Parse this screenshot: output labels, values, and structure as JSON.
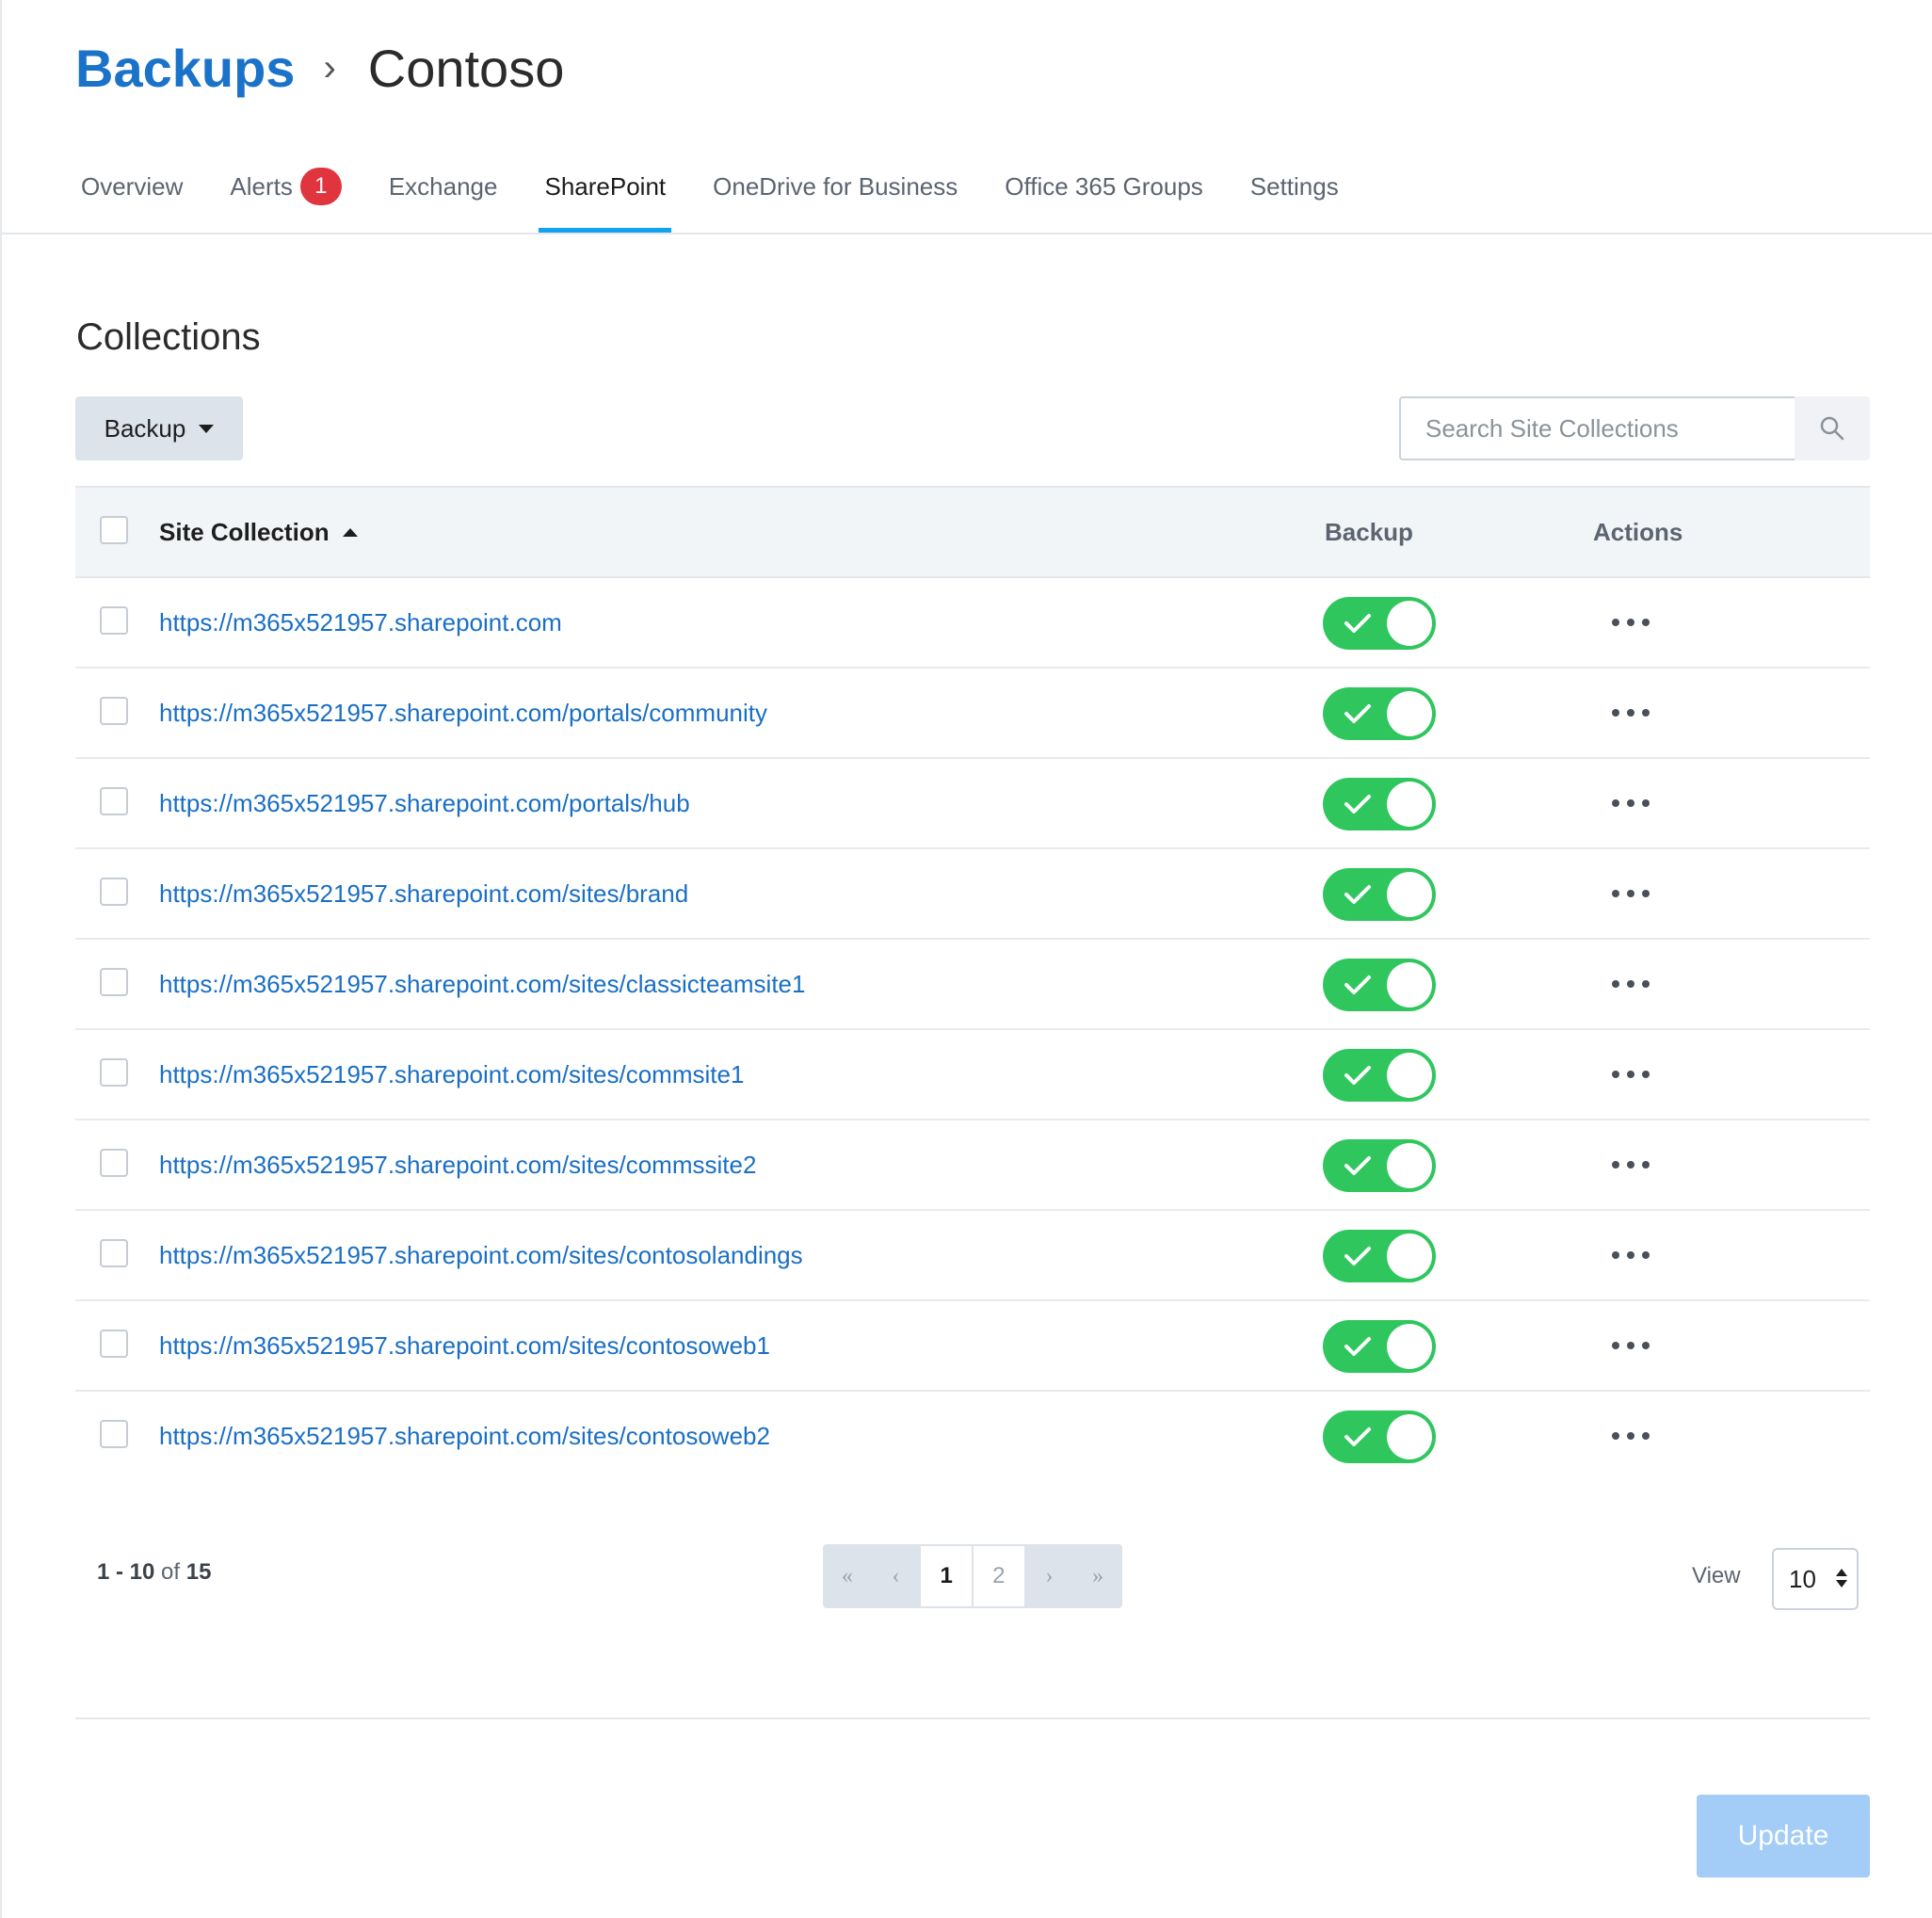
{
  "breadcrumb": {
    "root": "Backups",
    "separator": "›",
    "current": "Contoso"
  },
  "tabs": [
    {
      "label": "Overview"
    },
    {
      "label": "Alerts",
      "badge": "1"
    },
    {
      "label": "Exchange"
    },
    {
      "label": "SharePoint",
      "active": true
    },
    {
      "label": "OneDrive for Business"
    },
    {
      "label": "Office 365 Groups"
    },
    {
      "label": "Settings"
    }
  ],
  "section": {
    "title": "Collections",
    "dropdown_label": "Backup",
    "search_placeholder": "Search Site Collections"
  },
  "table": {
    "columns": {
      "site": "Site Collection",
      "backup": "Backup",
      "actions": "Actions"
    },
    "rows": [
      {
        "site": "https://m365x521957.sharepoint.com",
        "backup": true
      },
      {
        "site": "https://m365x521957.sharepoint.com/portals/community",
        "backup": true
      },
      {
        "site": "https://m365x521957.sharepoint.com/portals/hub",
        "backup": true
      },
      {
        "site": "https://m365x521957.sharepoint.com/sites/brand",
        "backup": true
      },
      {
        "site": "https://m365x521957.sharepoint.com/sites/classicteamsite1",
        "backup": true
      },
      {
        "site": "https://m365x521957.sharepoint.com/sites/commsite1",
        "backup": true
      },
      {
        "site": "https://m365x521957.sharepoint.com/sites/commssite2",
        "backup": true
      },
      {
        "site": "https://m365x521957.sharepoint.com/sites/contosolandings",
        "backup": true
      },
      {
        "site": "https://m365x521957.sharepoint.com/sites/contosoweb1",
        "backup": true
      },
      {
        "site": "https://m365x521957.sharepoint.com/sites/contosoweb2",
        "backup": true
      }
    ]
  },
  "footer": {
    "range": "1 - 10",
    "of": "of",
    "total": "15",
    "pagination": {
      "first": "«",
      "prev": "‹",
      "pages": [
        "1",
        "2"
      ],
      "current": "1",
      "next": "›",
      "last": "»"
    },
    "view_label": "View",
    "view_value": "10",
    "update_label": "Update"
  },
  "colors": {
    "link": "#1a6fc4",
    "accent_underline": "#12a3f0",
    "badge": "#e0343e",
    "toggle_on": "#2fc65e",
    "update_disabled": "#a3cdf6"
  },
  "icons": {
    "search": "magnifier-icon",
    "more": "more-horizontal-icon",
    "check": "check-icon"
  }
}
